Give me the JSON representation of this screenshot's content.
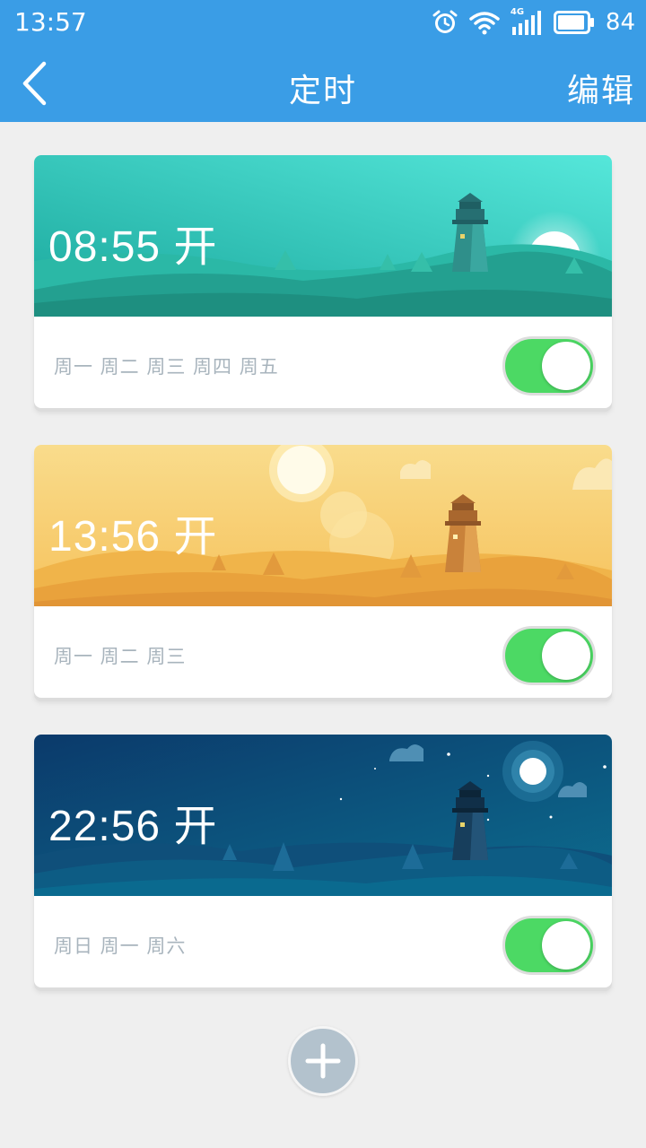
{
  "status_bar": {
    "time": "13:57",
    "network": "4G",
    "battery": "84",
    "icons": [
      "alarm-icon",
      "wifi-icon",
      "signal-icon",
      "battery-icon"
    ]
  },
  "app_bar": {
    "title": "定时",
    "edit_label": "编辑",
    "back_icon": "chevron-left-icon"
  },
  "timers": [
    {
      "time_label": "08:55 开",
      "days": "周一 周二 周三 周四 周五",
      "enabled": true,
      "theme": "morning"
    },
    {
      "time_label": "13:56 开",
      "days": "周一 周二 周三",
      "enabled": true,
      "theme": "noon"
    },
    {
      "time_label": "22:56 开",
      "days": "周日 周一 周六",
      "enabled": true,
      "theme": "night"
    }
  ],
  "add_button": {
    "icon": "plus-icon"
  },
  "colors": {
    "primary": "#3a9de6",
    "toggle_on": "#4cd964",
    "days_text": "#a8b4bd",
    "add_button": "#b3c2cd"
  }
}
